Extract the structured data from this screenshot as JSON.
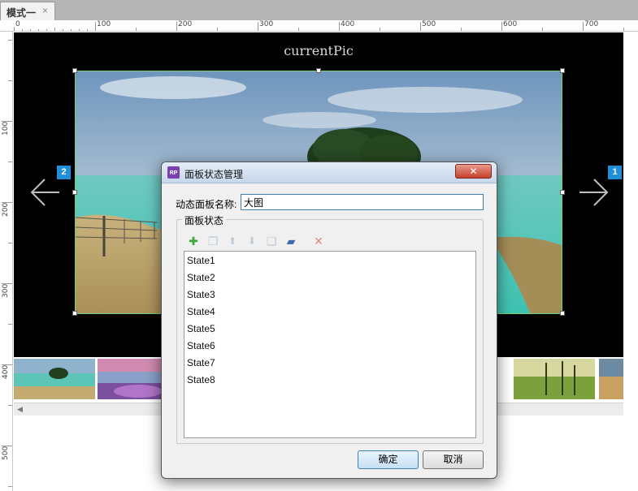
{
  "tab": {
    "label": "模式一",
    "close": "×"
  },
  "ruler": {
    "h_labels": [
      "0",
      "100",
      "200",
      "300",
      "400",
      "500",
      "600",
      "700"
    ],
    "v_labels": [
      "100",
      "200",
      "300",
      "400",
      "500"
    ]
  },
  "canvas": {
    "title": "currentPic",
    "badge_left": "2",
    "badge_right": "1"
  },
  "dialog": {
    "title": "面板状态管理",
    "logo": "RP",
    "close": "✕",
    "name_label": "动态面板名称:",
    "name_value": "大图",
    "group_label": "面板状态",
    "toolbar": {
      "add": "✚",
      "duplicate": "❐",
      "move_up": "⬆",
      "move_down": "⬇",
      "copy": "❏",
      "edit": "▰",
      "delete": "✕"
    },
    "states": [
      "State1",
      "State2",
      "State3",
      "State4",
      "State5",
      "State6",
      "State7",
      "State8"
    ],
    "ok": "确定",
    "cancel": "取消"
  },
  "colors": {
    "badge": "#1e8fd8",
    "selection_border": "#6fd46f",
    "add_icon": "#3aa83a",
    "delete_icon": "#e08a8a"
  }
}
